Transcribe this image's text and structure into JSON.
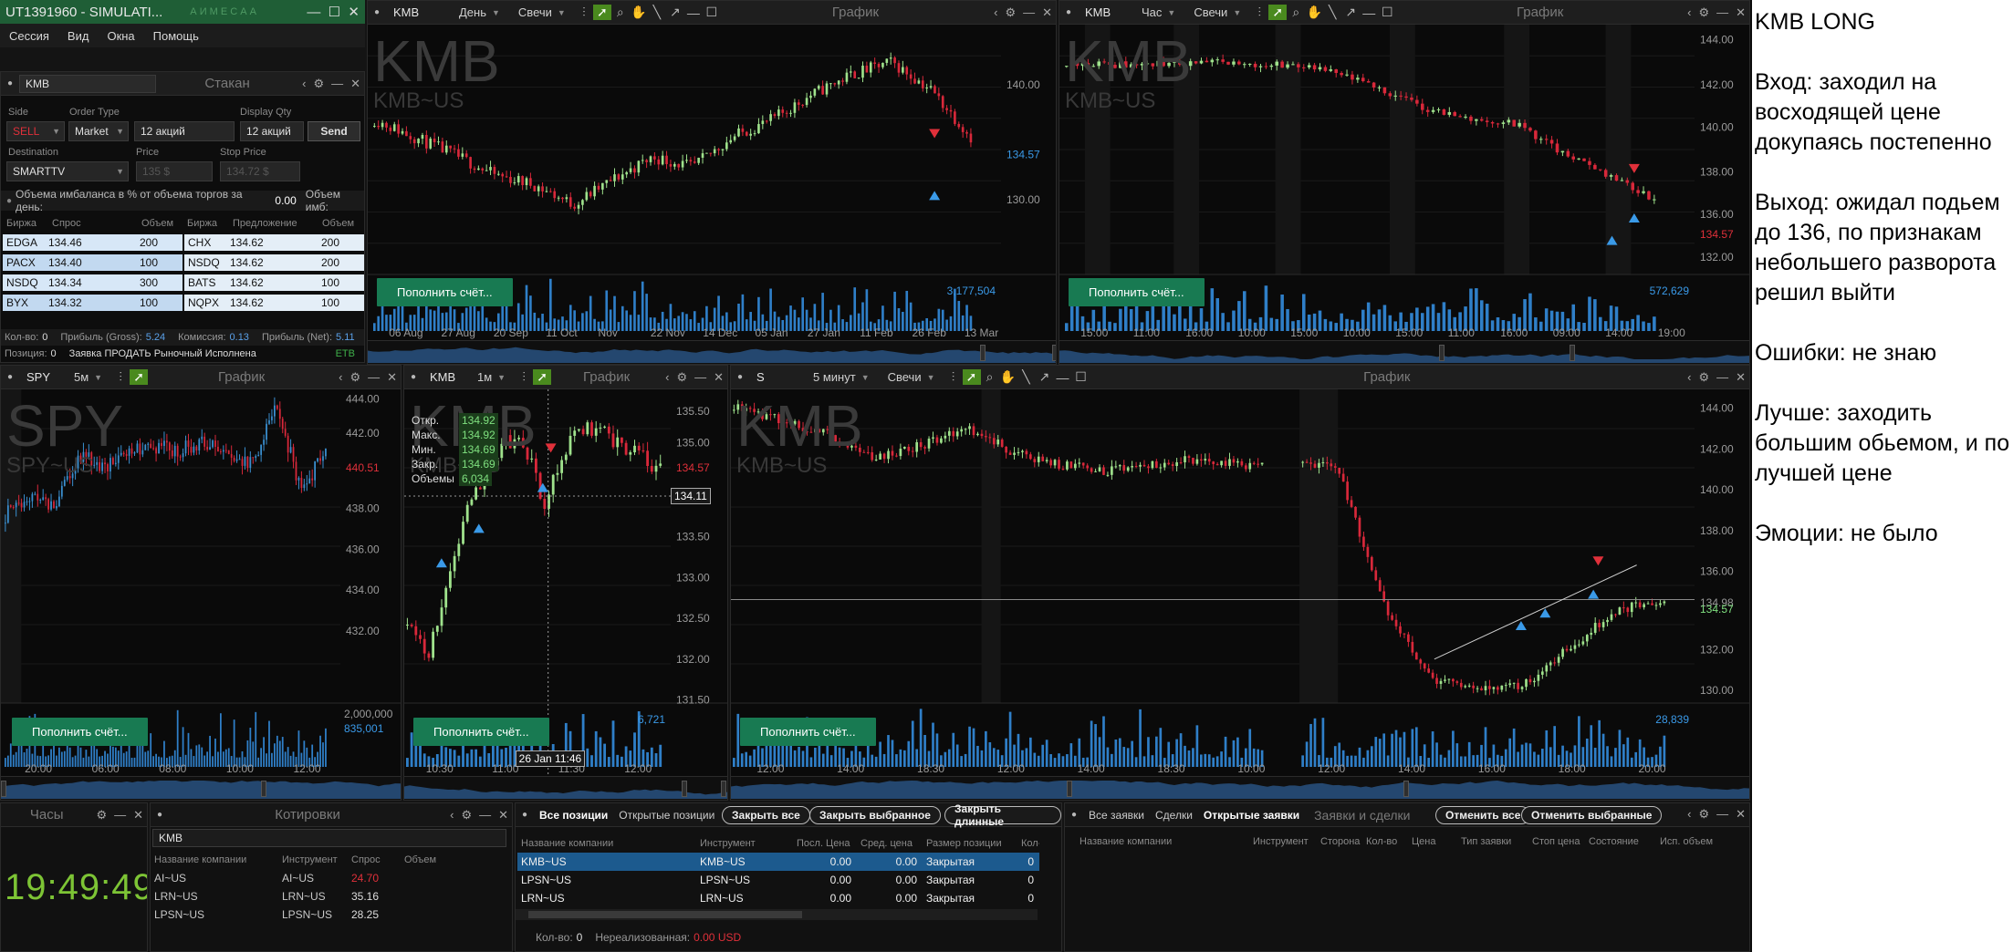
{
  "window": {
    "title": "UT1391960 - SIMULATI...",
    "title_icons": "А И M Е С А А",
    "menu": [
      "Сессия",
      "Вид",
      "Окна",
      "Помощь"
    ]
  },
  "order_entry": {
    "symbol": "KMB",
    "title": "Стакан",
    "labels": {
      "side": "Side",
      "order_type": "Order Type",
      "qty": "",
      "display_qty": "Display Qty",
      "destination": "Destination",
      "price": "Price",
      "stop_price": "Stop Price"
    },
    "side": "SELL",
    "order_type": "Market",
    "qty": "12 акций",
    "display_qty": "12 акций",
    "send": "Send",
    "destination": "SMARTTV",
    "price_placeholder": "135 $",
    "stop_placeholder": "134.72 $",
    "imbalance_label": "Объема имбаланса в % от объема торгов за день:",
    "imbalance_value": "0.00",
    "imbalance_vol_label": "Объем имб:",
    "book_headers": [
      "Биржа",
      "Спрос",
      "Объем",
      "Биржа",
      "Предложение",
      "Объем"
    ],
    "bids": [
      {
        "ex": "EDGA",
        "price": "134.46",
        "vol": "200"
      },
      {
        "ex": "PACX",
        "price": "134.40",
        "vol": "100"
      },
      {
        "ex": "NSDQ",
        "price": "134.34",
        "vol": "300"
      },
      {
        "ex": "BYX",
        "price": "134.32",
        "vol": "100"
      }
    ],
    "asks": [
      {
        "ex": "CHX",
        "price": "134.62",
        "vol": "200"
      },
      {
        "ex": "NSDQ",
        "price": "134.62",
        "vol": "200"
      },
      {
        "ex": "BATS",
        "price": "134.62",
        "vol": "100"
      },
      {
        "ex": "NQPX",
        "price": "134.62",
        "vol": "100"
      }
    ],
    "status1": {
      "qty_label": "Кол-во:",
      "qty": "0",
      "gross_label": "Прибыль (Gross):",
      "gross": "5.24",
      "comm_label": "Комиссия:",
      "comm": "0.13",
      "net_label": "Прибыль (Net):",
      "net": "5.11"
    },
    "status2": {
      "pos_label": "Позиция:",
      "pos": "0",
      "msg": "Заявка ПРОДАТЬ Рыночный Исполнена",
      "tag": "ETB"
    }
  },
  "charts": {
    "daily": {
      "symbol": "KMB",
      "period": "День",
      "style": "Свечи",
      "title": "График",
      "watermark": "KMB",
      "sub": "KMB~US",
      "x_labels": [
        "06 Aug",
        "27 Aug",
        "20 Sep",
        "11 Oct",
        "Nov",
        "22 Nov",
        "14 Dec",
        "05 Jan",
        "27 Jan",
        "11 Feb",
        "26 Feb",
        "13 Mar"
      ],
      "y_labels": [
        "140.00",
        "134.57",
        "130.00"
      ],
      "volume_label": "3,177,504",
      "refill": "Пополнить счёт..."
    },
    "hourly": {
      "symbol": "KMB",
      "period": "Час",
      "style": "Свечи",
      "title": "График",
      "watermark": "KMB",
      "sub": "KMB~US",
      "x_labels": [
        "15:00",
        "11:00",
        "16:00",
        "10:00",
        "15:00",
        "10:00",
        "15:00",
        "11:00",
        "16:00",
        "09:00",
        "14:00",
        "19:00"
      ],
      "y_labels": [
        "144.00",
        "142.00",
        "140.00",
        "138.00",
        "136.00",
        "134.57",
        "132.00"
      ],
      "volume_label": "572,629",
      "refill": "Пополнить счёт..."
    },
    "spy": {
      "symbol": "SPY",
      "period": "5м",
      "title": "График",
      "watermark": "SPY",
      "sub": "SPY~US",
      "x_labels": [
        "20:00",
        "06:00",
        "08:00",
        "10:00",
        "12:00"
      ],
      "y_labels": [
        "444.00",
        "442.00",
        "440.51",
        "438.00",
        "436.00",
        "434.00",
        "432.00"
      ],
      "volume_labels": [
        "2,000,000",
        "835,001"
      ],
      "refill": "Пополнить счёт..."
    },
    "minute": {
      "symbol": "KMB",
      "period": "1м",
      "title": "График",
      "watermark": "KMB",
      "sub": "KMB~US",
      "ohlc": [
        {
          "k": "Откр.",
          "v": "134.92"
        },
        {
          "k": "Макс.",
          "v": "134.92"
        },
        {
          "k": "Мин.",
          "v": "134.69"
        },
        {
          "k": "Закр.",
          "v": "134.69"
        },
        {
          "k": "Объемы",
          "v": "6,034"
        }
      ],
      "x_labels": [
        "10:30",
        "11:00",
        "11:30",
        "12:00"
      ],
      "y_labels": [
        "135.50",
        "135.00",
        "134.57",
        "134.11",
        "133.50",
        "133.00",
        "132.50",
        "132.00",
        "131.50"
      ],
      "crosshair_price": "134.11",
      "crosshair_time": "26 Jan 11:46",
      "volume_label": "6,721",
      "refill": "Пополнить счёт..."
    },
    "five_min": {
      "symbol": "S",
      "period": "5 минут",
      "style": "Свечи",
      "title": "График",
      "watermark": "KMB",
      "sub": "KMB~US",
      "x_labels": [
        "12:00",
        "14:00",
        "18:30",
        "12:00",
        "14:00",
        "18:30",
        "10:00",
        "12:00",
        "14:00",
        "16:00",
        "18:00",
        "20:00"
      ],
      "y_labels": [
        "144.00",
        "142.00",
        "140.00",
        "138.00",
        "136.00",
        "134.98",
        "134.57",
        "132.00",
        "130.00"
      ],
      "volume_label": "28,839",
      "refill": "Пополнить счёт..."
    }
  },
  "clock": {
    "title": "Часы",
    "time": "19:49:49"
  },
  "quotes": {
    "title": "Котировки",
    "input": "KMB",
    "headers": [
      "Название компании",
      "Инструмент",
      "Спрос",
      "Объем"
    ],
    "rows": [
      {
        "name": "AI~US",
        "inst": "AI~US",
        "bid": "24.70"
      },
      {
        "name": "LRN~US",
        "inst": "LRN~US",
        "bid": "35.16"
      },
      {
        "name": "LPSN~US",
        "inst": "LPSN~US",
        "bid": "28.25"
      }
    ]
  },
  "positions": {
    "tabs": [
      "Все позиции",
      "Открытые позиции"
    ],
    "buttons": [
      "Закрыть все",
      "Закрыть выбранное",
      "Закрыть длинные"
    ],
    "headers": [
      "Название компании",
      "Инструмент",
      "Посл. Цена",
      "Сред. цена",
      "Размер позиции",
      "Кол-во"
    ],
    "rows": [
      {
        "name": "KMB~US",
        "inst": "KMB~US",
        "last": "0.00",
        "avg": "0.00",
        "state": "Закрытая",
        "qty": "0"
      },
      {
        "name": "LPSN~US",
        "inst": "LPSN~US",
        "last": "0.00",
        "avg": "0.00",
        "state": "Закрытая",
        "qty": "0"
      },
      {
        "name": "LRN~US",
        "inst": "LRN~US",
        "last": "0.00",
        "avg": "0.00",
        "state": "Закрытая",
        "qty": "0"
      }
    ],
    "footer_qty_label": "Кол-во:",
    "footer_qty": "0",
    "footer_unreal_label": "Нереализованная:",
    "footer_unreal": "0.00 USD"
  },
  "orders": {
    "tabs": [
      "Все заявки",
      "Сделки",
      "Открытые заявки"
    ],
    "title": "Заявки и сделки",
    "buttons": [
      "Отменить все",
      "Отменить выбранные"
    ],
    "headers": [
      "Название компании",
      "Инструмент",
      "Сторона",
      "Кол-во",
      "Цена",
      "Тип заявки",
      "Стоп цена",
      "Состояние",
      "Исп. объем"
    ]
  },
  "notes": [
    "KMB LONG",
    "Вход: заходил на восходящей цене докупаясь постепенно",
    "Выход: ожидал подьем до 136, по признакам небольшего разворота решил выйти",
    "Ошибки: не знаю",
    "Лучше: заходить большим обьемом, и по лучшей цене",
    "Эмоции: не было"
  ],
  "colors": {
    "up": "#9fe28c",
    "down": "#d8283a",
    "up_alt": "#3a8fd0",
    "refill": "#187a52",
    "accent": "#4a8a1e",
    "titlebar": "#1f5e36"
  }
}
